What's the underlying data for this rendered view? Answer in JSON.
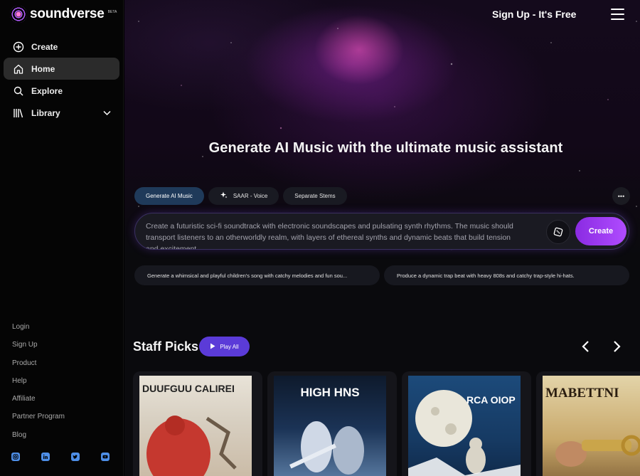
{
  "brand": {
    "name": "soundverse",
    "badge": "BETA"
  },
  "nav": [
    {
      "label": "Create",
      "icon": "plus-circle-icon"
    },
    {
      "label": "Home",
      "icon": "home-icon"
    },
    {
      "label": "Explore",
      "icon": "search-icon"
    },
    {
      "label": "Library",
      "icon": "library-icon"
    }
  ],
  "footer_links": [
    "Login",
    "Sign Up",
    "Product",
    "Help",
    "Affiliate",
    "Partner Program",
    "Blog"
  ],
  "socials": [
    "instagram-icon",
    "linkedin-icon",
    "twitter-icon",
    "youtube-icon"
  ],
  "header": {
    "signup": "Sign Up - It's Free"
  },
  "hero": {
    "title": "Generate AI Music with the ultimate music assistant"
  },
  "tabs": [
    {
      "label": "Generate AI Music",
      "active": true
    },
    {
      "label": "SAAR - Voice",
      "active": false
    },
    {
      "label": "Separate Stems",
      "active": false
    }
  ],
  "prompt": {
    "text": "Create a futuristic sci-fi soundtrack with electronic soundscapes and pulsating synth rhythms. The music should transport listeners to an otherworldly realm, with layers of ethereal synths and dynamic beats that build tension and excitement.",
    "create_label": "Create"
  },
  "suggestions": [
    "Generate a whimsical and playful children's song with catchy melodies and fun sou...",
    "Produce a dynamic trap beat with heavy 808s and catchy trap-style hi-hats."
  ],
  "staff_picks": {
    "title": "Staff Picks",
    "play_all": "Play All",
    "cards": [
      {
        "art_text": "DUUFGUU CALIREI"
      },
      {
        "art_text": "HIGH HNS"
      },
      {
        "art_text": "RCA OIOP"
      },
      {
        "art_text": "MABETTNI"
      }
    ]
  },
  "colors": {
    "accent": "#8a2be2",
    "active_tab": "#1f3a5a",
    "play_all": "#5b3bd8"
  }
}
